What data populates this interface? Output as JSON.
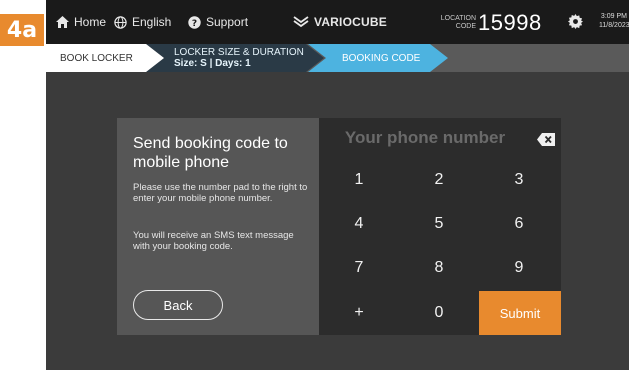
{
  "step_badge": "4a",
  "topbar": {
    "home_label": "Home",
    "language_label": "English",
    "support_label": "Support",
    "brand": "VARIOCUBE",
    "location_label_line1": "LOCATION",
    "location_label_line2": "CODE",
    "location_code": "15998",
    "time": "3:09 PM",
    "date": "11/8/2023"
  },
  "breadcrumb": {
    "step1": "BOOK LOCKER",
    "step2_title": "LOCKER SIZE & DURATION",
    "step2_sub": "Size: S | Days: 1",
    "step3": "BOOKING CODE"
  },
  "info": {
    "title": "Send booking code to mobile phone",
    "text1": "Please use the number pad to the right to enter your mobile phone number.",
    "text2": "You will receive an SMS text message with your booking code.",
    "back_label": "Back"
  },
  "keypad": {
    "placeholder": "Your phone number",
    "keys": [
      "1",
      "2",
      "3",
      "4",
      "5",
      "6",
      "7",
      "8",
      "9",
      "+",
      "0"
    ],
    "submit_label": "Submit"
  },
  "colors": {
    "accent_orange": "#e88a2e",
    "accent_blue": "#4db3e0",
    "topbar": "#1a1a1a"
  }
}
